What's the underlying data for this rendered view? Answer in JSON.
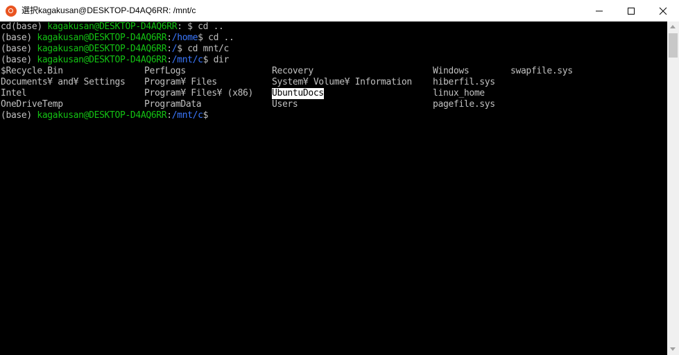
{
  "window": {
    "title": "選択kagakusan@DESKTOP-D4AQ6RR: /mnt/c",
    "icon": "ubuntu-icon"
  },
  "colors": {
    "prompt_user": "#13c213",
    "prompt_path": "#3b78ff",
    "text": "#c0c0c0",
    "background": "#000000"
  },
  "terminal": {
    "lines": [
      {
        "pre": "cd(base) ",
        "user": "kagakusan@DESKTOP-D4AQ6RR",
        "colon": ":",
        "path": "",
        "cmd": " $ cd .."
      },
      {
        "pre": "(base) ",
        "user": "kagakusan@DESKTOP-D4AQ6RR",
        "colon": ":",
        "path": "/home",
        "cmd": "$ cd .."
      },
      {
        "pre": "(base) ",
        "user": "kagakusan@DESKTOP-D4AQ6RR",
        "colon": ":",
        "path": "/",
        "cmd": "$ cd mnt/c"
      },
      {
        "pre": "(base) ",
        "user": "kagakusan@DESKTOP-D4AQ6RR",
        "colon": ":",
        "path": "/mnt/c",
        "cmd": "$ dir"
      }
    ],
    "listing": [
      [
        "$Recycle.Bin",
        "PerfLogs",
        "Recovery",
        "Windows",
        "swapfile.sys"
      ],
      [
        "Documents¥ and¥ Settings",
        "Program¥ Files",
        "System¥ Volume¥ Information",
        "hiberfil.sys",
        ""
      ],
      [
        "Intel",
        "Program¥ Files¥ (x86)",
        "UbuntuDocs",
        "linux_home",
        ""
      ],
      [
        "OneDriveTemp",
        "ProgramData",
        "Users",
        "pagefile.sys",
        ""
      ]
    ],
    "final_prompt": {
      "pre": "(base) ",
      "user": "kagakusan@DESKTOP-D4AQ6RR",
      "colon": ":",
      "path": "/mnt/c",
      "cmd": "$"
    }
  }
}
